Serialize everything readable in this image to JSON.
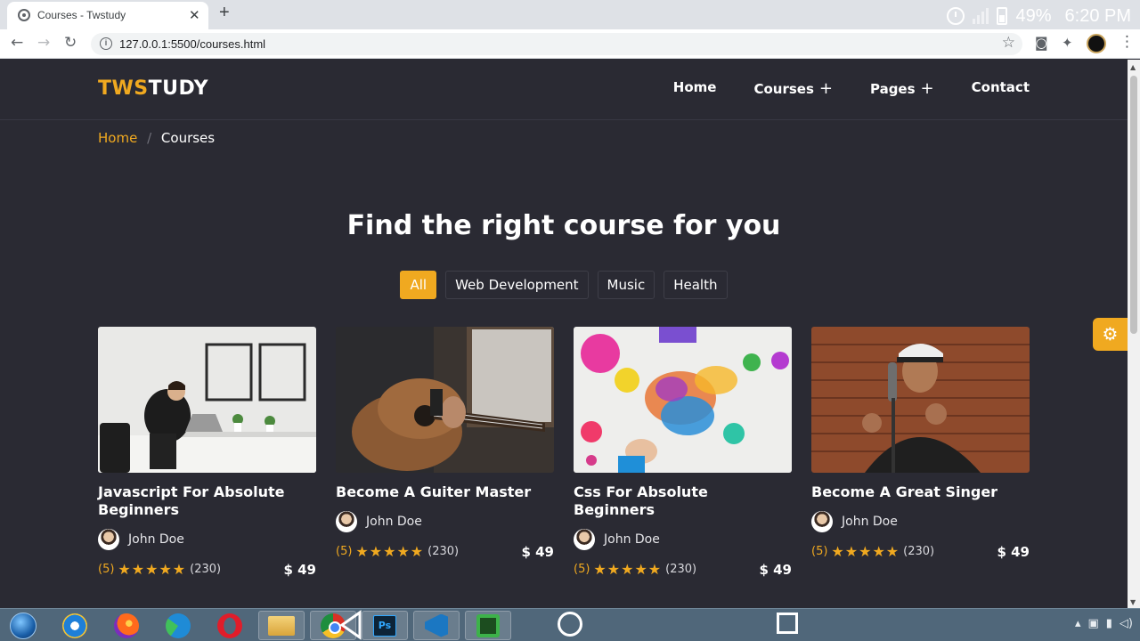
{
  "browser": {
    "tab_title": "Courses - Twstudy",
    "tab_close": "✕",
    "new_tab": "+",
    "url": "127.0.0.1:5500/courses.html",
    "back": "←",
    "forward": "→",
    "reload": "↻"
  },
  "status_bar": {
    "battery": "49%",
    "time": "6:20 PM"
  },
  "site": {
    "logo_accent": "TWS",
    "logo_rest": "TUDY",
    "nav": [
      {
        "label": "Home"
      },
      {
        "label": "Courses",
        "plus": "+"
      },
      {
        "label": "Pages",
        "plus": "+"
      },
      {
        "label": "Contact"
      }
    ],
    "breadcrumb": {
      "home": "Home",
      "separator": "/",
      "current": "Courses"
    },
    "section_title": "Find the right course for you",
    "filters": [
      "All",
      "Web Development",
      "Music",
      "Health"
    ],
    "active_filter": "All"
  },
  "courses": [
    {
      "title": "Javascript For Absolute Beginners",
      "author": "John Doe",
      "rating": "(5)",
      "stars": "★★★★★",
      "reviews": "(230)",
      "price": "$ 49",
      "image": "man-at-laptop"
    },
    {
      "title": "Become A Guiter Master",
      "author": "John Doe",
      "rating": "(5)",
      "stars": "★★★★★",
      "reviews": "(230)",
      "price": "$ 49",
      "image": "guitar"
    },
    {
      "title": "Css For Absolute Beginners",
      "author": "John Doe",
      "rating": "(5)",
      "stars": "★★★★★",
      "reviews": "(230)",
      "price": "$ 49",
      "image": "paint-splatter"
    },
    {
      "title": "Become A Great Singer",
      "author": "John Doe",
      "rating": "(5)",
      "stars": "★★★★★",
      "reviews": "(230)",
      "price": "$ 49",
      "image": "singer-microphone"
    }
  ],
  "colors": {
    "accent": "#f0a920",
    "background": "#2a2a33",
    "text": "#ffffff"
  },
  "icons": {
    "settings": "gear-icon",
    "star": "star-icon"
  }
}
